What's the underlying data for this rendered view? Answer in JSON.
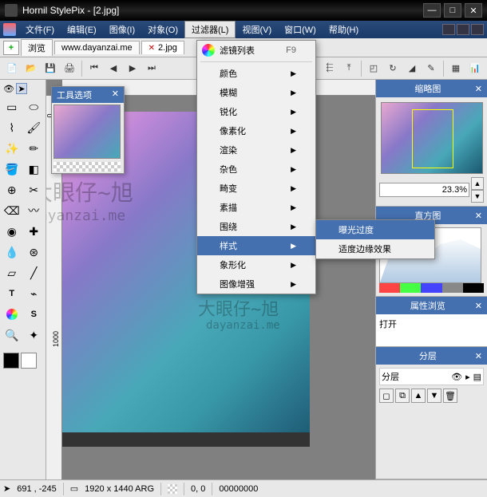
{
  "title": "Hornil StylePix - [2.jpg]",
  "menubar": [
    "文件(F)",
    "编辑(E)",
    "图像(I)",
    "对象(O)",
    "过滤器(L)",
    "视图(V)",
    "窗口(W)",
    "帮助(H)"
  ],
  "active_menu_index": 4,
  "tabs": {
    "browse": "浏览",
    "url": "www.dayanzai.me",
    "file": "2.jpg"
  },
  "tool_options": {
    "title": "工具选项"
  },
  "filter_menu": {
    "list_label": "滤镜列表",
    "list_shortcut": "F9",
    "items": [
      "颜色",
      "模糊",
      "锐化",
      "像素化",
      "渲染",
      "杂色",
      "畸变",
      "素描",
      "围绕",
      "样式",
      "象形化",
      "图像增强"
    ],
    "highlighted": 9
  },
  "submenu": {
    "items": [
      "曝光过度",
      "适度边缘效果"
    ],
    "highlighted": 0
  },
  "panels": {
    "thumbnail": "缩略图",
    "histogram": "直方图",
    "properties": "属性浏览",
    "layers": "分层",
    "zoom": "23.3%",
    "prop_value": "打开",
    "layer_name": "分层"
  },
  "statusbar": {
    "coords": "691 , -245",
    "dimensions": "1920 x 1440 ARG",
    "origin": "0, 0",
    "zeros": "00000000"
  },
  "ruler_v": [
    "0",
    "1000"
  ],
  "watermarks": {
    "main1": "大眼仔~旭",
    "main2": "dayanzai.me",
    "right1": "大眼仔~旭",
    "right2": "dayanzai.me"
  }
}
